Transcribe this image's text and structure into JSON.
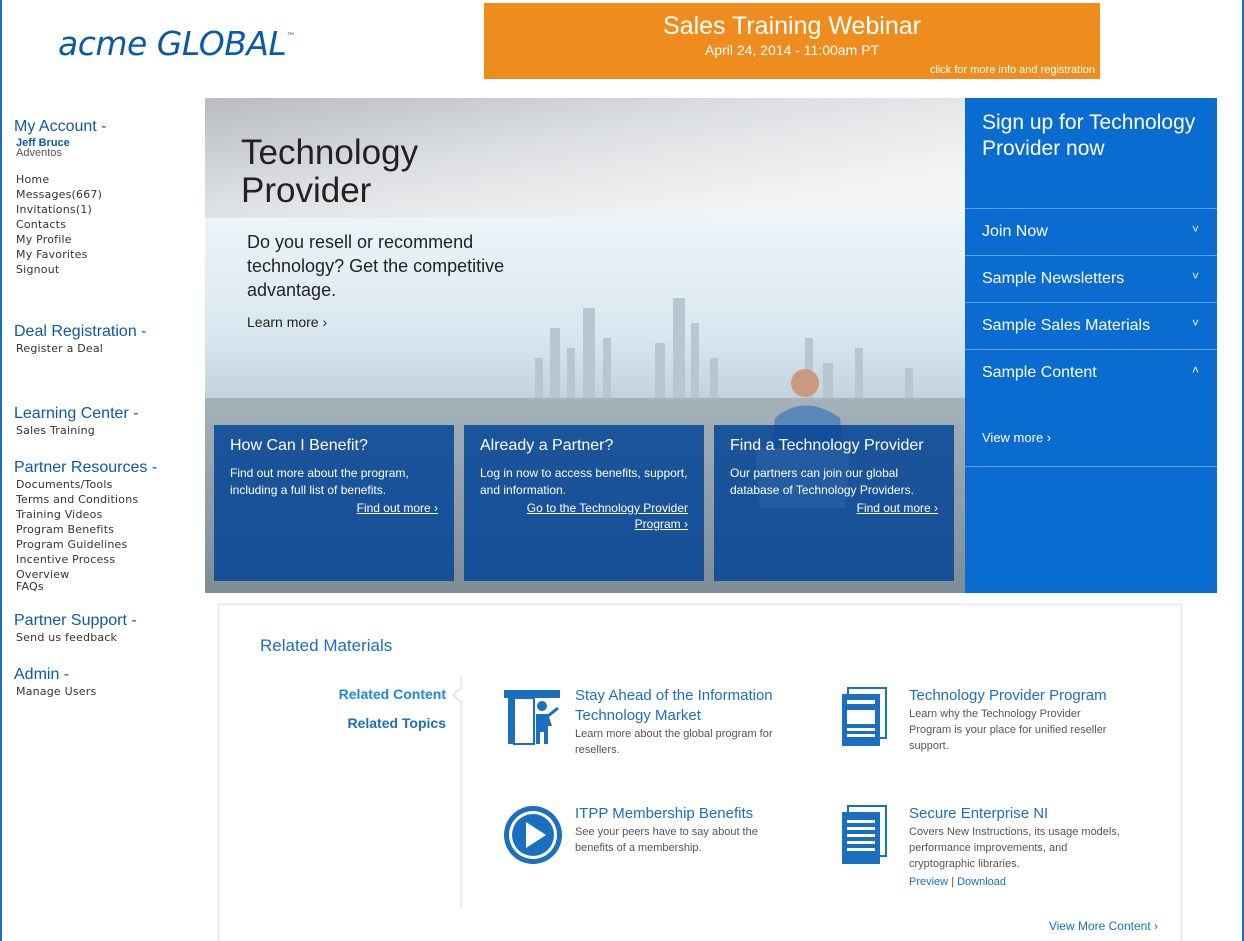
{
  "header": {
    "logo_text": "acme GLOBAL",
    "logo_tm": "™",
    "banner": {
      "title": "Sales Training Webinar",
      "date": "April 24, 2014 - 11:00am PT",
      "cta": "click for more info and registration"
    }
  },
  "sidebar": {
    "account": {
      "title": "My Account -",
      "user_name": "Jeff Bruce",
      "company": "Adventos",
      "links": [
        "Home",
        "Messages(667)",
        "Invitations(1)",
        "Contacts",
        "My Profile",
        "My Favorites",
        "Signout"
      ]
    },
    "deal": {
      "title": "Deal Registration -",
      "links": [
        "Register a Deal"
      ]
    },
    "learning": {
      "title": "Learning Center -",
      "links": [
        "Sales Training"
      ]
    },
    "resources": {
      "title": "Partner Resources -",
      "links": [
        "Documents/Tools",
        "Terms and Conditions",
        "Training Videos",
        "Program Benefits",
        "Program Guidelines",
        "Incentive Process",
        "Overview",
        "FAQs"
      ]
    },
    "support": {
      "title": "Partner Support -",
      "links": [
        "Send us feedback"
      ]
    },
    "admin": {
      "title": "Admin -",
      "links": [
        "Manage Users"
      ]
    }
  },
  "hero": {
    "title_line1": "Technology",
    "title_line2": "Provider",
    "description": "Do you resell or recommend technology? Get the competitive advantage.",
    "learn_more": "Learn more ›",
    "cards": [
      {
        "title": "How Can I Benefit?",
        "body": "Find out more about the program, including a full list of benefits.",
        "link": "Find out more ›"
      },
      {
        "title": "Already a Partner?",
        "body": "Log in now to access benefits, support, and information.",
        "link_line1": "Go to the  Technology Provider",
        "link_line2": "Program ›"
      },
      {
        "title": "Find a Technology Provider",
        "body": "Our partners can join our global database of Technology Providers.",
        "link": "Find out more ›"
      }
    ]
  },
  "signup": {
    "title": "Sign up for Technology Provider now",
    "items": [
      {
        "label": "Join Now",
        "chevron": "˅"
      },
      {
        "label": "Sample Newsletters",
        "chevron": "˅"
      },
      {
        "label": "Sample Sales Materials",
        "chevron": "˅"
      },
      {
        "label": "Sample Content",
        "chevron": "˄"
      }
    ],
    "view_more": "View more ›"
  },
  "related": {
    "heading": "Related Materials",
    "tabs": [
      "Related Content",
      "Related Topics"
    ],
    "items": [
      {
        "title": "Stay Ahead of the Information Technology Market",
        "desc": "Learn more about the global program for resellers.",
        "icon": "presenter-icon"
      },
      {
        "title": "Technology Provider Program",
        "desc": "Learn why the Technology Provider Program is your place for unified reseller support.",
        "icon": "document-icon"
      },
      {
        "title": "ITPP Membership Benefits",
        "desc": "See your peers have to say about the benefits of a membership.",
        "icon": "play-icon"
      },
      {
        "title": "Secure Enterprise NI",
        "desc": "Covers New Instructions, its usage models, performance improvements, and cryptographic libraries.",
        "icon": "document-icon",
        "preview": "Preview",
        "separator": "|",
        "download": "Download"
      }
    ],
    "view_more": "View More Content ›"
  },
  "colors": {
    "brand_blue": "#0b5aa6",
    "signup_blue": "#0a6cd0",
    "banner_orange": "#ee8d1d"
  }
}
